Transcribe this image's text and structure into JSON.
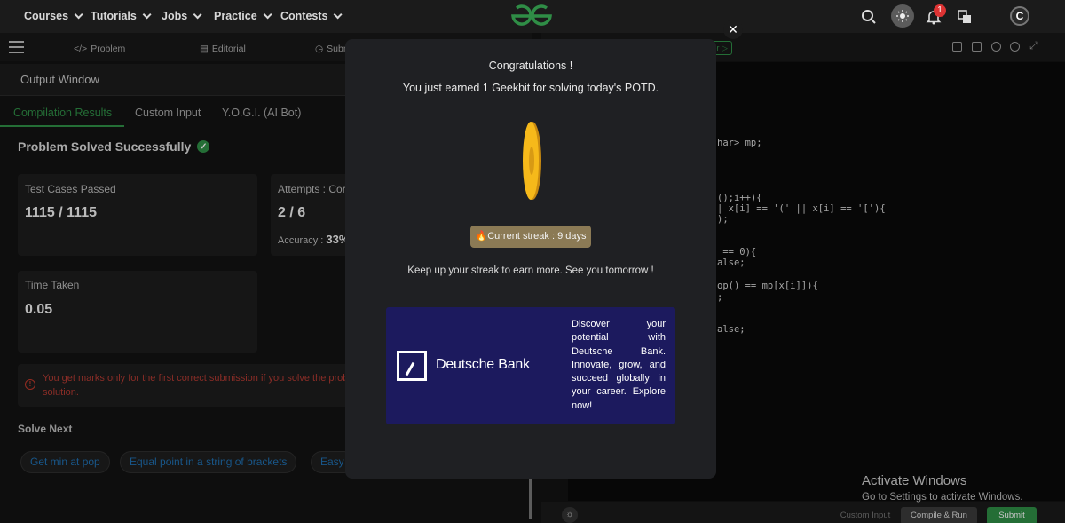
{
  "topnav": {
    "items": [
      {
        "label": "Courses"
      },
      {
        "label": "Tutorials"
      },
      {
        "label": "Jobs"
      },
      {
        "label": "Practice"
      },
      {
        "label": "Contests"
      }
    ],
    "notification_count": "1",
    "icons": [
      "search-icon",
      "theme-toggle-icon",
      "bell-icon",
      "translate-icon",
      "profile-icon"
    ]
  },
  "subtabs": {
    "problem": "Problem",
    "editorial": "Editorial",
    "submissions": "Subm"
  },
  "output": {
    "title": "Output Window",
    "tabs": [
      "Compilation Results",
      "Custom Input",
      "Y.O.G.I. (AI Bot)"
    ],
    "status": "Problem Solved Successfully",
    "test_cases_label": "Test Cases Passed",
    "test_cases_value": "1115 / 1115",
    "attempts_label": "Attempts : Corr",
    "attempts_value": "2 / 6",
    "accuracy_label": "Accuracy :",
    "accuracy_value": "33%",
    "time_label": "Time Taken",
    "time_value": "0.05",
    "warning": "You get marks only for the first correct submission if you solve the prob solution.",
    "solve_next": "Solve Next",
    "chips": [
      "Get min at pop",
      "Equal point in a string of brackets",
      "Easy"
    ]
  },
  "editor": {
    "prime_label": "mer",
    "code_lines": [
      "har> mp;",
      "();i++){",
      "| x[i] == '(' || x[i] == '['){",
      ");",
      " == 0){",
      "alse;",
      "op() == mp[x[i]]){",
      ";",
      "alse;"
    ],
    "custom_input": "Custom Input",
    "compile_run": "Compile & Run",
    "submit": "Submit"
  },
  "activate": {
    "title": "Activate Windows",
    "subtitle": "Go to Settings to activate Windows."
  },
  "modal": {
    "close_symbol": "✕",
    "title": "Congratulations !",
    "subtitle": "You just earned 1 Geekbit for solving today's POTD.",
    "streak": "🔥Current streak : 9 days",
    "keep_up": "Keep up your streak to earn more. See you tomorrow !",
    "ad": {
      "brand": "Deutsche Bank",
      "text": "Discover your potential with Deutsche Bank. Innovate, grow, and succeed globally in your career. Explore now!",
      "background": "#1c1a5e"
    }
  },
  "colors": {
    "accent": "#2f8d46",
    "warning": "#b23a32",
    "link": "#1f6fb0",
    "coin": "#f6b91a"
  }
}
